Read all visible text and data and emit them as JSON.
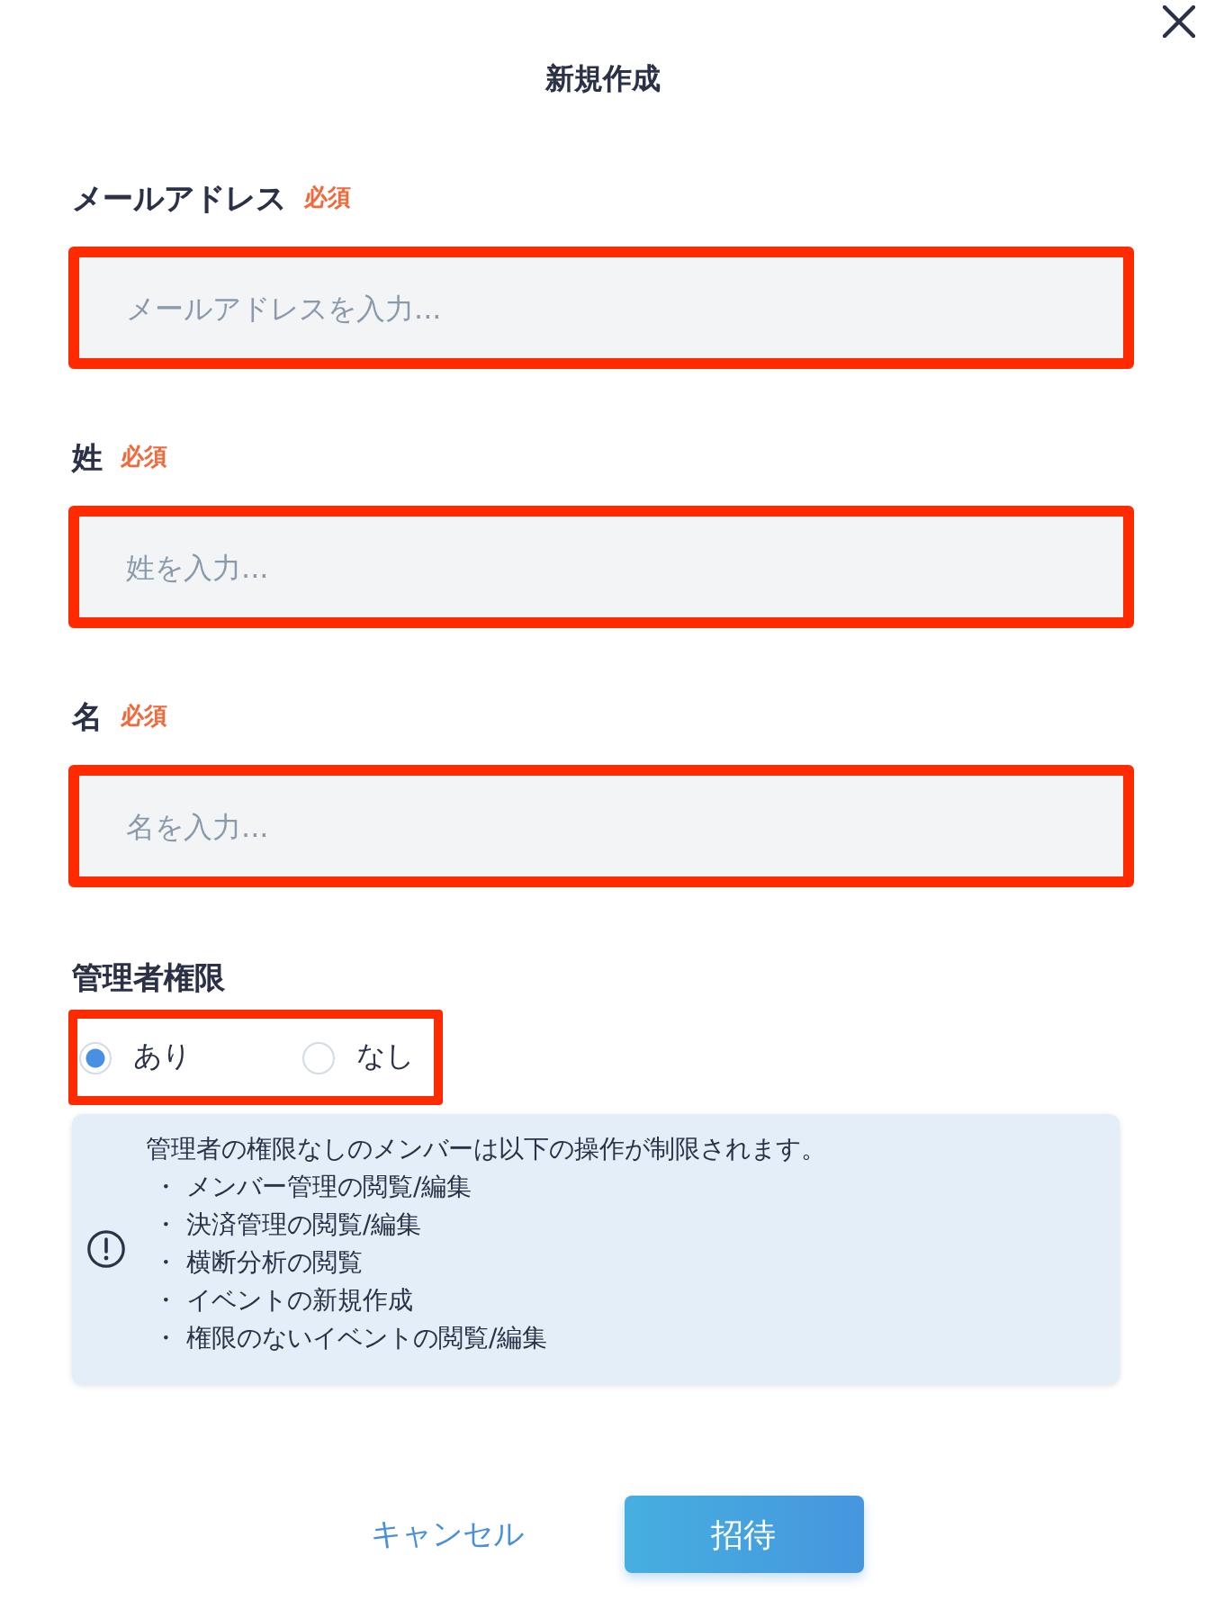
{
  "dialog": {
    "title": "新規作成"
  },
  "fields": [
    {
      "label": "メールアドレス",
      "required_label": "必須",
      "placeholder": "メールアドレスを入力...",
      "highlighted": true
    },
    {
      "label": "姓",
      "required_label": "必須",
      "placeholder": "姓を入力...",
      "highlighted": true
    },
    {
      "label": "名",
      "required_label": "必須",
      "placeholder": "名を入力...",
      "highlighted": true
    }
  ],
  "admin_permission": {
    "label": "管理者権限",
    "highlighted": true,
    "options": [
      {
        "label": "あり",
        "selected": true
      },
      {
        "label": "なし",
        "selected": false
      }
    ]
  },
  "notice": {
    "text": "管理者の権限なしのメンバーは以下の操作が制限されます。",
    "items": [
      "・ メンバー管理の閲覧/編集",
      "・ 決済管理の閲覧/編集",
      "・ 横断分析の閲覧",
      "・ イベントの新規作成",
      "・ 権限のないイベントの閲覧/編集"
    ]
  },
  "buttons": [
    {
      "kind": "text",
      "label": "キャンセル"
    },
    {
      "kind": "primary",
      "label": "招待"
    }
  ]
}
